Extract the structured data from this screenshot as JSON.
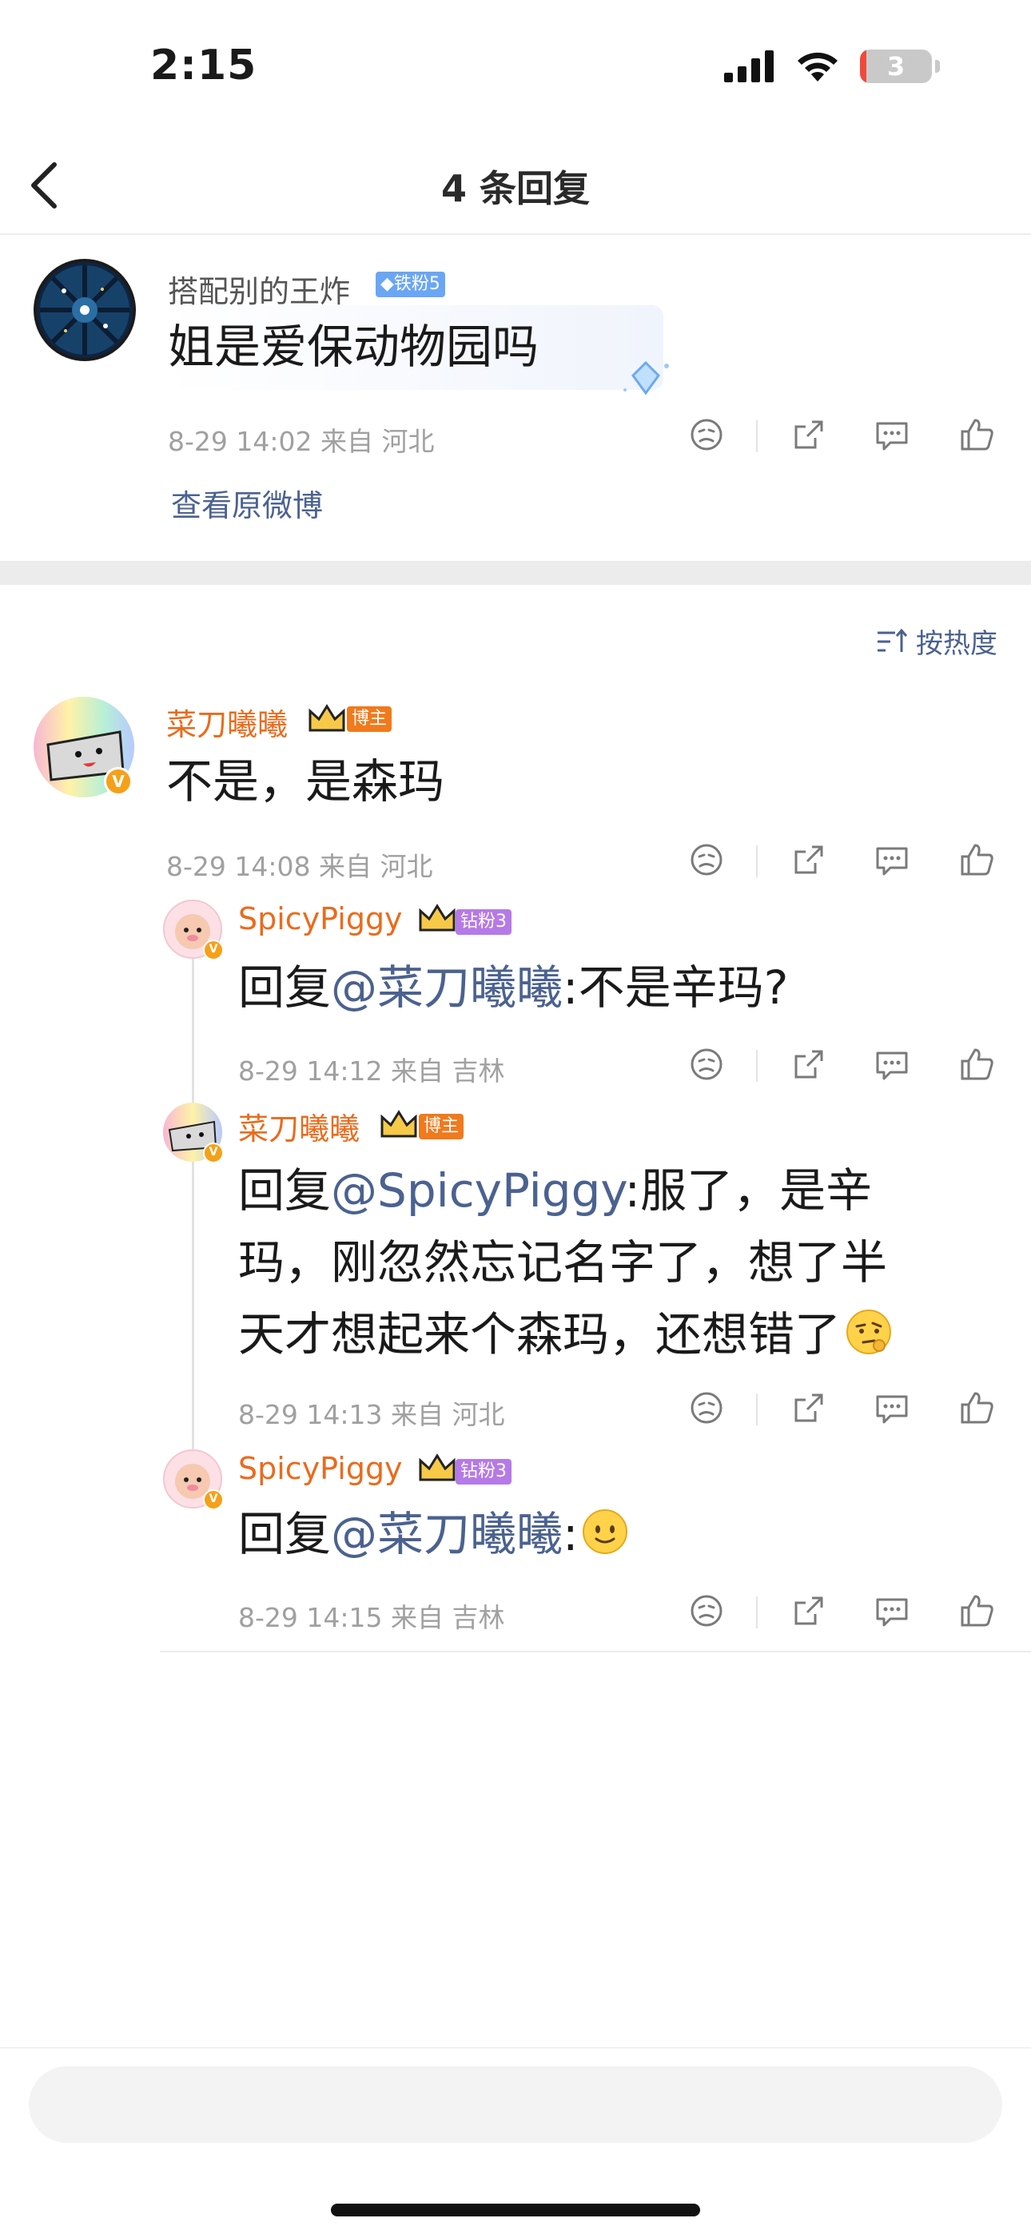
{
  "status_bar": {
    "time": "2:15",
    "battery": "3"
  },
  "nav": {
    "title": "4 条回复"
  },
  "main_comment": {
    "username": "搭配别的王炸",
    "badge": "铁粉5",
    "text": "姐是爱保动物园吗",
    "meta": "8-29 14:02 来自 河北",
    "view_original": "查看原微博"
  },
  "sort": {
    "label": "按热度"
  },
  "replies": [
    {
      "username": "菜刀曦曦",
      "badge": "博主",
      "text": "不是，是森玛",
      "meta": "8-29 14:08 来自 河北"
    },
    {
      "username": "SpicyPiggy",
      "badge": "钻粉3",
      "reply_prefix": "回复",
      "mention": "@菜刀曦曦",
      "text": ":不是辛玛?",
      "meta": "8-29 14:12 来自 吉林"
    },
    {
      "username": "菜刀曦曦",
      "badge": "博主",
      "reply_prefix": "回复",
      "mention": "@SpicyPiggy",
      "text_line1": ":服了，是辛",
      "text_line2": "玛，刚忽然忘记名字了，想了半",
      "text_line3": "天才想起来个森玛，还想错了",
      "meta": "8-29 14:13 来自 河北"
    },
    {
      "username": "SpicyPiggy",
      "badge": "钻粉3",
      "reply_prefix": "回复",
      "mention": "@菜刀曦曦",
      "text": ":",
      "meta": "8-29 14:15 来自 吉林"
    }
  ],
  "composer": {
    "placeholder": ""
  },
  "colors": {
    "link": "#4b6290",
    "blogger_name": "#ea6b1c",
    "meta_gray": "#a0a0a0",
    "vip_badge": "#f6a019"
  },
  "icons": [
    "back-icon",
    "signal-icon",
    "wifi-icon",
    "battery-icon",
    "dislike-icon",
    "share-icon",
    "comment-icon",
    "like-icon",
    "sort-icon",
    "crown-icon",
    "verified-icon",
    "diamond-icon",
    "thinking-emoji-icon",
    "smile-emoji-icon"
  ]
}
